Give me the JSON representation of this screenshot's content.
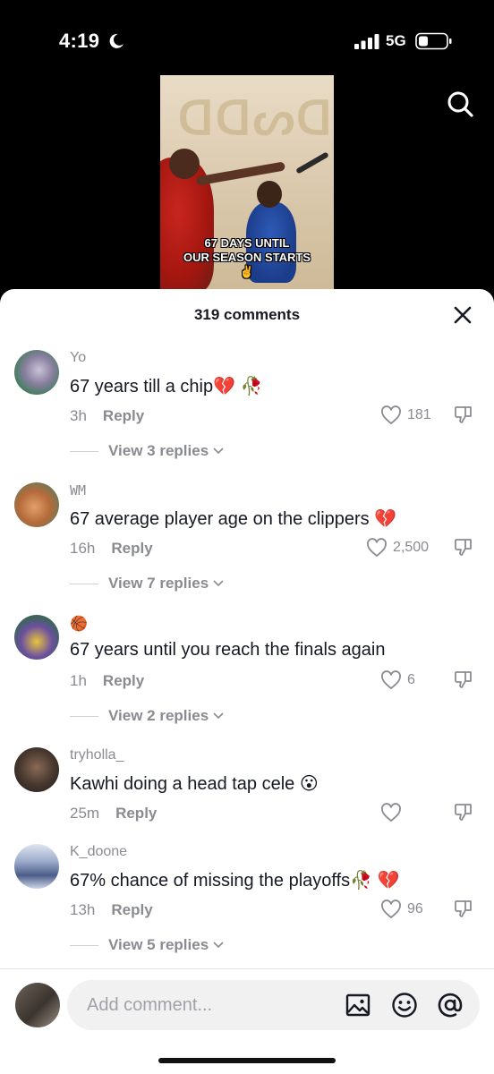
{
  "status_bar": {
    "time": "4:19",
    "network": "5G",
    "icons": [
      "moon-icon",
      "signal-icon",
      "battery-icon"
    ]
  },
  "video": {
    "caption_line1": "67 DAYS UNTIL",
    "caption_line2": "OUR SEASON STARTS",
    "caption_emoji": "✌️"
  },
  "sheet": {
    "title": "319 comments"
  },
  "comments": [
    {
      "username": "Yo",
      "text": "67 years till a chip💔 🥀",
      "time": "3h",
      "reply_label": "Reply",
      "likes": "181",
      "view_replies": "View 3 replies"
    },
    {
      "username": "WM",
      "text": "67 average player age on the clippers 💔",
      "time": "16h",
      "reply_label": "Reply",
      "likes": "2,500",
      "view_replies": "View 7 replies"
    },
    {
      "username": "🏀",
      "text": "67 years until you reach the finals again",
      "time": "1h",
      "reply_label": "Reply",
      "likes": "6",
      "view_replies": "View 2 replies"
    },
    {
      "username": "tryholla_",
      "text": "Kawhi doing a head tap cele 😮",
      "time": "25m",
      "reply_label": "Reply",
      "likes": "",
      "view_replies": ""
    },
    {
      "username": "K_doone",
      "text": "67% chance of missing the playoffs🥀 💔",
      "time": "13h",
      "reply_label": "Reply",
      "likes": "96",
      "view_replies": "View 5 replies"
    }
  ],
  "composer": {
    "placeholder": "Add comment...",
    "icons": [
      "image-icon",
      "emoji-icon",
      "mention-icon"
    ]
  },
  "colors": {
    "text_primary": "#161823",
    "text_secondary": "#8a8b91",
    "input_bg": "#f1f1f2"
  }
}
